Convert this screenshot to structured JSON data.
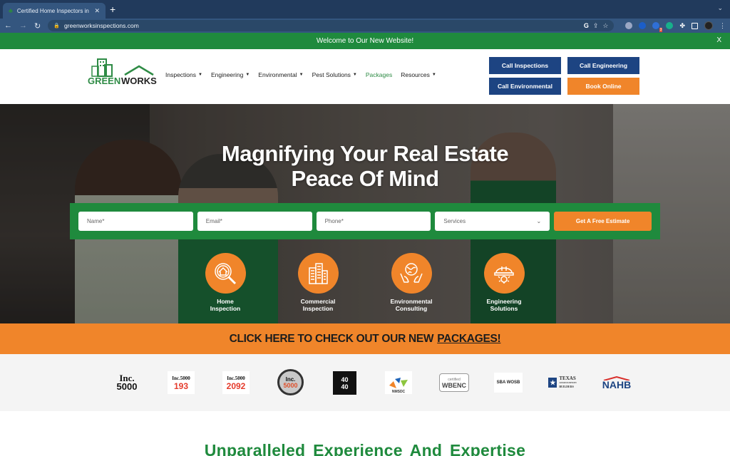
{
  "browser": {
    "tab_title": "Certified Home Inspectors in T",
    "url": "greenworksinspections.com",
    "extension_badge": "3"
  },
  "banner": {
    "text": "Welcome to Our New Website!",
    "close_label": "X"
  },
  "header": {
    "logo_text_1": "GREEN",
    "logo_text_2": "WORKS",
    "nav": [
      {
        "label": "Inspections",
        "dropdown": true
      },
      {
        "label": "Engineering",
        "dropdown": true
      },
      {
        "label": "Environmental",
        "dropdown": true
      },
      {
        "label": "Pest Solutions",
        "dropdown": true
      },
      {
        "label": "Packages",
        "dropdown": false
      },
      {
        "label": "Resources",
        "dropdown": true
      }
    ],
    "cta": {
      "call_inspections": "Call Inspections",
      "call_engineering": "Call Engineering",
      "call_environmental": "Call Environmental",
      "book_online": "Book Online"
    }
  },
  "hero": {
    "title_line1": "Magnifying Your Real Estate",
    "title_line2": "Peace Of Mind",
    "form": {
      "name_placeholder": "Name*",
      "email_placeholder": "Email*",
      "phone_placeholder": "Phone*",
      "services_selected": "Services",
      "submit_label": "Get A Free Estimate"
    },
    "services": [
      {
        "line1": "Home",
        "line2": "Inspection",
        "icon": "home-magnifier-icon"
      },
      {
        "line1": "Commercial",
        "line2": "Inspection",
        "icon": "buildings-icon"
      },
      {
        "line1": "Environmental",
        "line2": "Consulting",
        "icon": "globe-hands-icon"
      },
      {
        "line1": "Engineering",
        "line2": "Solutions",
        "icon": "hardhat-gear-icon"
      }
    ]
  },
  "promo": {
    "text": "CLICK HERE TO CHECK OUT OUR NEW",
    "link": "PACKAGES!"
  },
  "badges": {
    "inc_top": "Inc.",
    "inc_bottom": "5000",
    "inc5000_header": "Inc.5000",
    "rank_1": "193",
    "rank_2": "2092",
    "forty_top": "40",
    "forty_bottom": "40",
    "nmsdc": "NMSDC",
    "wbenc_small": "certified",
    "wbenc": "WBENC",
    "sba": "SBA WOSB",
    "texas_1": "TEXAS",
    "texas_2": "ASSOCIATION",
    "texas_3": "BUILDERS",
    "nahb": "NAHB"
  },
  "section": {
    "heading": "Unparalleled Experience And Expertise"
  },
  "colors": {
    "green": "#1f8a3d",
    "orange": "#f0852a",
    "navy": "#1d4482"
  }
}
